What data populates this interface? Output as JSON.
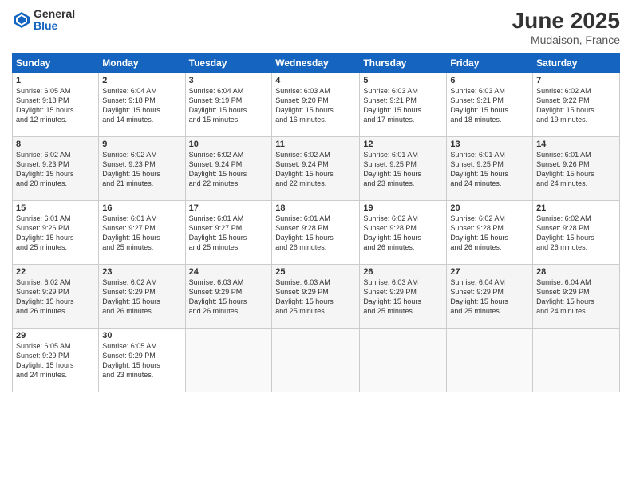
{
  "header": {
    "logo_general": "General",
    "logo_blue": "Blue",
    "title": "June 2025",
    "location": "Mudaison, France"
  },
  "weekdays": [
    "Sunday",
    "Monday",
    "Tuesday",
    "Wednesday",
    "Thursday",
    "Friday",
    "Saturday"
  ],
  "weeks": [
    [
      {
        "day": "1",
        "info": "Sunrise: 6:05 AM\nSunset: 9:18 PM\nDaylight: 15 hours\nand 12 minutes."
      },
      {
        "day": "2",
        "info": "Sunrise: 6:04 AM\nSunset: 9:18 PM\nDaylight: 15 hours\nand 14 minutes."
      },
      {
        "day": "3",
        "info": "Sunrise: 6:04 AM\nSunset: 9:19 PM\nDaylight: 15 hours\nand 15 minutes."
      },
      {
        "day": "4",
        "info": "Sunrise: 6:03 AM\nSunset: 9:20 PM\nDaylight: 15 hours\nand 16 minutes."
      },
      {
        "day": "5",
        "info": "Sunrise: 6:03 AM\nSunset: 9:21 PM\nDaylight: 15 hours\nand 17 minutes."
      },
      {
        "day": "6",
        "info": "Sunrise: 6:03 AM\nSunset: 9:21 PM\nDaylight: 15 hours\nand 18 minutes."
      },
      {
        "day": "7",
        "info": "Sunrise: 6:02 AM\nSunset: 9:22 PM\nDaylight: 15 hours\nand 19 minutes."
      }
    ],
    [
      {
        "day": "8",
        "info": "Sunrise: 6:02 AM\nSunset: 9:23 PM\nDaylight: 15 hours\nand 20 minutes."
      },
      {
        "day": "9",
        "info": "Sunrise: 6:02 AM\nSunset: 9:23 PM\nDaylight: 15 hours\nand 21 minutes."
      },
      {
        "day": "10",
        "info": "Sunrise: 6:02 AM\nSunset: 9:24 PM\nDaylight: 15 hours\nand 22 minutes."
      },
      {
        "day": "11",
        "info": "Sunrise: 6:02 AM\nSunset: 9:24 PM\nDaylight: 15 hours\nand 22 minutes."
      },
      {
        "day": "12",
        "info": "Sunrise: 6:01 AM\nSunset: 9:25 PM\nDaylight: 15 hours\nand 23 minutes."
      },
      {
        "day": "13",
        "info": "Sunrise: 6:01 AM\nSunset: 9:25 PM\nDaylight: 15 hours\nand 24 minutes."
      },
      {
        "day": "14",
        "info": "Sunrise: 6:01 AM\nSunset: 9:26 PM\nDaylight: 15 hours\nand 24 minutes."
      }
    ],
    [
      {
        "day": "15",
        "info": "Sunrise: 6:01 AM\nSunset: 9:26 PM\nDaylight: 15 hours\nand 25 minutes."
      },
      {
        "day": "16",
        "info": "Sunrise: 6:01 AM\nSunset: 9:27 PM\nDaylight: 15 hours\nand 25 minutes."
      },
      {
        "day": "17",
        "info": "Sunrise: 6:01 AM\nSunset: 9:27 PM\nDaylight: 15 hours\nand 25 minutes."
      },
      {
        "day": "18",
        "info": "Sunrise: 6:01 AM\nSunset: 9:28 PM\nDaylight: 15 hours\nand 26 minutes."
      },
      {
        "day": "19",
        "info": "Sunrise: 6:02 AM\nSunset: 9:28 PM\nDaylight: 15 hours\nand 26 minutes."
      },
      {
        "day": "20",
        "info": "Sunrise: 6:02 AM\nSunset: 9:28 PM\nDaylight: 15 hours\nand 26 minutes."
      },
      {
        "day": "21",
        "info": "Sunrise: 6:02 AM\nSunset: 9:28 PM\nDaylight: 15 hours\nand 26 minutes."
      }
    ],
    [
      {
        "day": "22",
        "info": "Sunrise: 6:02 AM\nSunset: 9:29 PM\nDaylight: 15 hours\nand 26 minutes."
      },
      {
        "day": "23",
        "info": "Sunrise: 6:02 AM\nSunset: 9:29 PM\nDaylight: 15 hours\nand 26 minutes."
      },
      {
        "day": "24",
        "info": "Sunrise: 6:03 AM\nSunset: 9:29 PM\nDaylight: 15 hours\nand 26 minutes."
      },
      {
        "day": "25",
        "info": "Sunrise: 6:03 AM\nSunset: 9:29 PM\nDaylight: 15 hours\nand 25 minutes."
      },
      {
        "day": "26",
        "info": "Sunrise: 6:03 AM\nSunset: 9:29 PM\nDaylight: 15 hours\nand 25 minutes."
      },
      {
        "day": "27",
        "info": "Sunrise: 6:04 AM\nSunset: 9:29 PM\nDaylight: 15 hours\nand 25 minutes."
      },
      {
        "day": "28",
        "info": "Sunrise: 6:04 AM\nSunset: 9:29 PM\nDaylight: 15 hours\nand 24 minutes."
      }
    ],
    [
      {
        "day": "29",
        "info": "Sunrise: 6:05 AM\nSunset: 9:29 PM\nDaylight: 15 hours\nand 24 minutes."
      },
      {
        "day": "30",
        "info": "Sunrise: 6:05 AM\nSunset: 9:29 PM\nDaylight: 15 hours\nand 23 minutes."
      },
      {
        "day": "",
        "info": ""
      },
      {
        "day": "",
        "info": ""
      },
      {
        "day": "",
        "info": ""
      },
      {
        "day": "",
        "info": ""
      },
      {
        "day": "",
        "info": ""
      }
    ]
  ]
}
